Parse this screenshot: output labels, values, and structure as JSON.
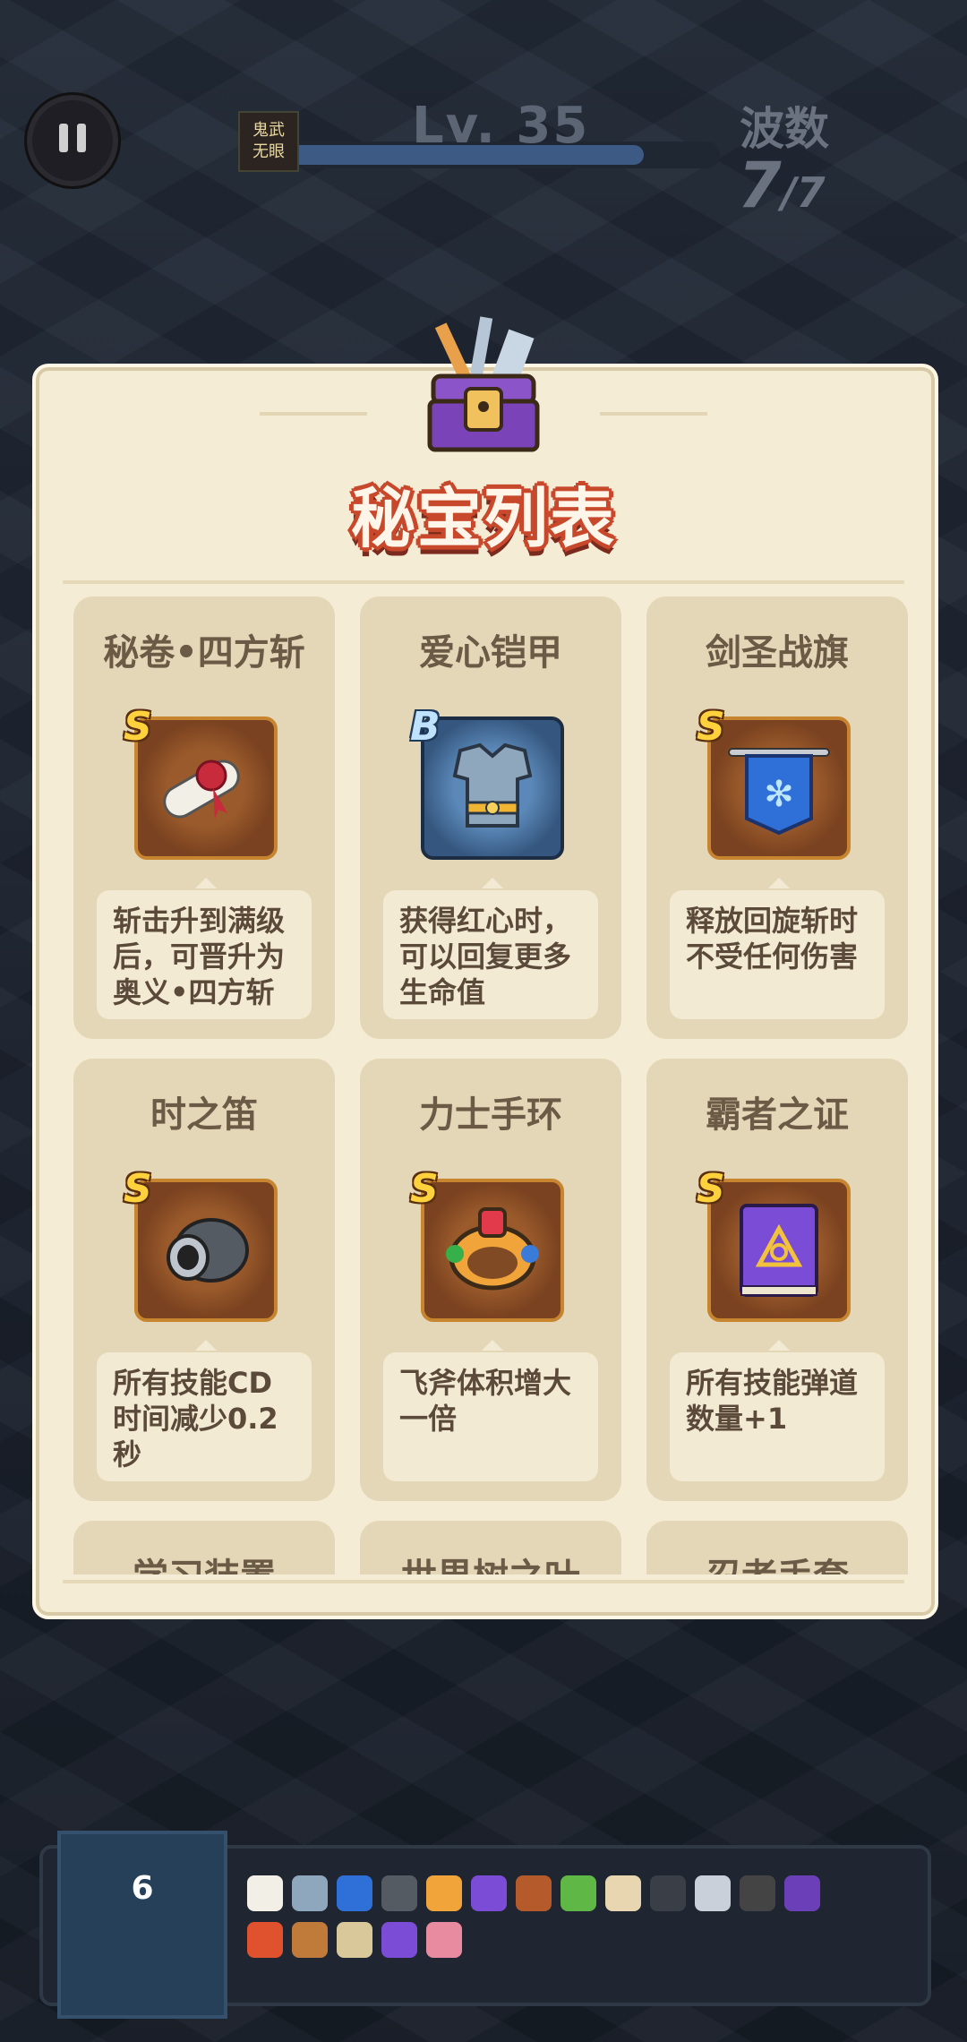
{
  "hud": {
    "avatar_text": "鬼武\n无眼",
    "level_text": "Lv. 35",
    "xp_progress": 0.82,
    "wave_label": "波数",
    "wave_current": "7",
    "wave_total": "/7"
  },
  "panel": {
    "title": "秘宝列表",
    "items": [
      {
        "name": "秘卷•四方斩",
        "grade": "S",
        "icon": "scroll-icon",
        "desc": "斩击升到满级后，可晋升为奥义•四方斩"
      },
      {
        "name": "爱心铠甲",
        "grade": "B",
        "icon": "armor-icon",
        "desc": "获得红心时，可以回复更多生命值"
      },
      {
        "name": "剑圣战旗",
        "grade": "S",
        "icon": "banner-icon",
        "desc": "释放回旋斩时不受任何伤害"
      },
      {
        "name": "时之笛",
        "grade": "S",
        "icon": "flute-icon",
        "desc": "所有技能CD时间减少0.2秒"
      },
      {
        "name": "力士手环",
        "grade": "S",
        "icon": "bracelet-icon",
        "desc": "飞斧体积增大一倍"
      },
      {
        "name": "霸者之证",
        "grade": "S",
        "icon": "spellbook-icon",
        "desc": "所有技能弹道数量+1"
      },
      {
        "name": "学习装置",
        "grade": "",
        "icon": "",
        "desc": ""
      },
      {
        "name": "世界树之叶",
        "grade": "",
        "icon": "",
        "desc": ""
      },
      {
        "name": "忍者手套",
        "grade": "",
        "icon": "",
        "desc": ""
      }
    ]
  },
  "bottom": {
    "book_count": "6"
  },
  "colors": {
    "title_outline": "#c8482c",
    "panel_bg": "#f5ecd6",
    "card_bg": "#e4d7b7"
  }
}
